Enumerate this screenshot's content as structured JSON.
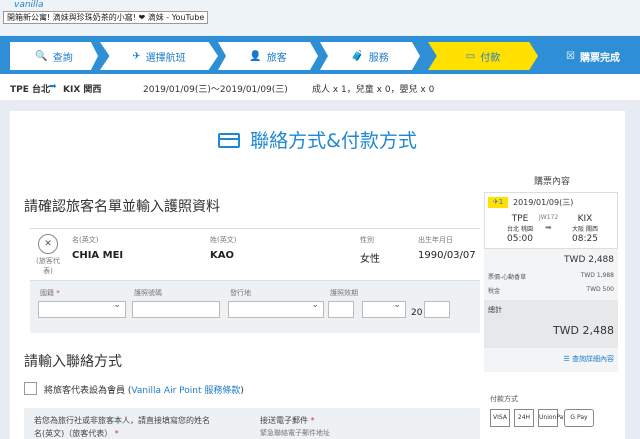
{
  "top": {
    "tooltip": "開箱新公寓! 滴妹與珍珠奶茶的小窩! ❤ 滴妹 - YouTube",
    "logo": "vanilla"
  },
  "steps": [
    {
      "icon": "search-icon",
      "label": "查詢"
    },
    {
      "icon": "plane-icon",
      "label": "選擇航班"
    },
    {
      "icon": "person-icon",
      "label": "旅客"
    },
    {
      "icon": "luggage-icon",
      "label": "服務"
    },
    {
      "icon": "card-icon",
      "label": "付款"
    },
    {
      "icon": "check-icon",
      "label": "購票完成"
    }
  ],
  "route": {
    "from": "TPE 台北",
    "arrow": "➡",
    "to": "KIX 関西",
    "dates": "2019/01/09(三)～2019/01/09(三)",
    "pax": "成人 x 1，兒童 x 0，嬰兒 x 0"
  },
  "page_title": "聯絡方式&付款方式",
  "section1": "請確認旅客名單並輸入護照資料",
  "passenger": {
    "rep": "(旅客代表)",
    "first_label": "名(英文)",
    "first": "CHIA MEI",
    "last_label": "姓(英文)",
    "last": "KAO",
    "gender_label": "性別",
    "gender": "女性",
    "dob_label": "出生年月日",
    "dob": "1990/03/07"
  },
  "form": {
    "nationality": "國籍",
    "req": "*",
    "passport": "護照號碼",
    "issue": "發行地",
    "expiry": "護照效期",
    "year_prefix": "20"
  },
  "section2": "請輸入聯絡方式",
  "member": {
    "text": "將旅客代表設為會員 (",
    "link": "Vanilla Air Point 服務條款",
    "end": ")"
  },
  "agent_note": "若您為旅行社或非旅客本人，請直接填寫您的姓名",
  "agent_field": "名(英文)（旅客代表）",
  "email_label": "接送電子郵件",
  "email_sub": "緊急聯絡電子郵件地址",
  "summary": {
    "header": "購票內容",
    "badge": "1",
    "date": "2019/01/09(三)",
    "from_code": "TPE",
    "from_city": "台北 桃園",
    "from_time": "05:00",
    "flight": "JW172",
    "to_code": "KIX",
    "to_city": "大阪 關西",
    "to_time": "08:25",
    "fare_total": "TWD 2,488",
    "fare_label": "票價-心動香草",
    "fare": "TWD 1,988",
    "tax_label": "稅金",
    "tax": "TWD 500",
    "total_label": "總計",
    "total": "TWD 2,488",
    "detail_link": "查詢詳細內容",
    "pay_label": "付款方式",
    "pay_methods": [
      "VISA",
      "24H",
      "UnionPay",
      "G Pay"
    ]
  }
}
